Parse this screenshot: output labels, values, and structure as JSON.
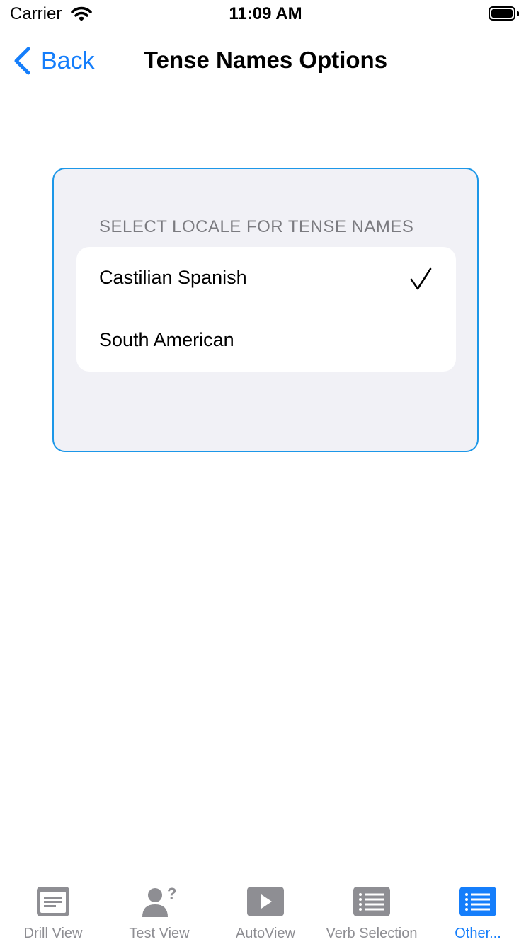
{
  "status_bar": {
    "carrier": "Carrier",
    "time": "11:09 AM",
    "icons": [
      "wifi-icon",
      "battery-icon"
    ]
  },
  "nav": {
    "back_label": "Back",
    "title": "Tense Names Options"
  },
  "settings": {
    "section_header": "SELECT LOCALE FOR TENSE NAMES",
    "options": [
      {
        "label": "Castilian Spanish",
        "selected": true
      },
      {
        "label": "South American",
        "selected": false
      }
    ]
  },
  "tab_bar": {
    "tabs": [
      {
        "label": "Drill View",
        "icon": "list-box-icon",
        "active": false
      },
      {
        "label": "Test View",
        "icon": "person-question-icon",
        "active": false
      },
      {
        "label": "AutoView",
        "icon": "play-icon",
        "active": false
      },
      {
        "label": "Verb Selection",
        "icon": "bulleted-list-icon",
        "active": false
      },
      {
        "label": "Other...",
        "icon": "bulleted-list-icon",
        "active": true
      }
    ]
  },
  "colors": {
    "accent": "#157efb",
    "panel_border": "#1c97e8",
    "panel_background": "#f1f1f6",
    "inactive_tab": "#8e8e93"
  }
}
